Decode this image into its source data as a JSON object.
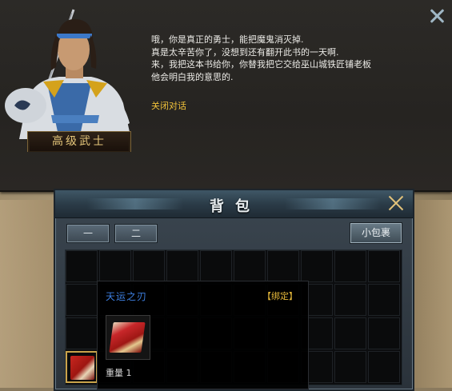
{
  "dialog": {
    "npc_name": "高级武士",
    "lines": [
      "哦，你是真正的勇士，能把魔鬼消灭掉.",
      "真是太辛苦你了，没想到还有翻开此书的一天啊.",
      "来，我把这本书给你，你替我把它交给巫山城铁匠铺老板",
      "他会明白我的意思的."
    ],
    "close_option": "关闭对话"
  },
  "bag": {
    "title": "背包",
    "tabs": [
      "一",
      "二"
    ],
    "small_bag_label": "小包裹"
  },
  "tooltip": {
    "item_name": "天运之刃",
    "bind_status": "【绑定】",
    "weight_label": "重量",
    "weight_value": "1"
  },
  "colors": {
    "npc_name": "#e5c67a",
    "dialog_text": "#ecebe7",
    "close_option": "#f2c33a",
    "item_name": "#3d7fe0",
    "bind_status": "#e6b93a"
  }
}
